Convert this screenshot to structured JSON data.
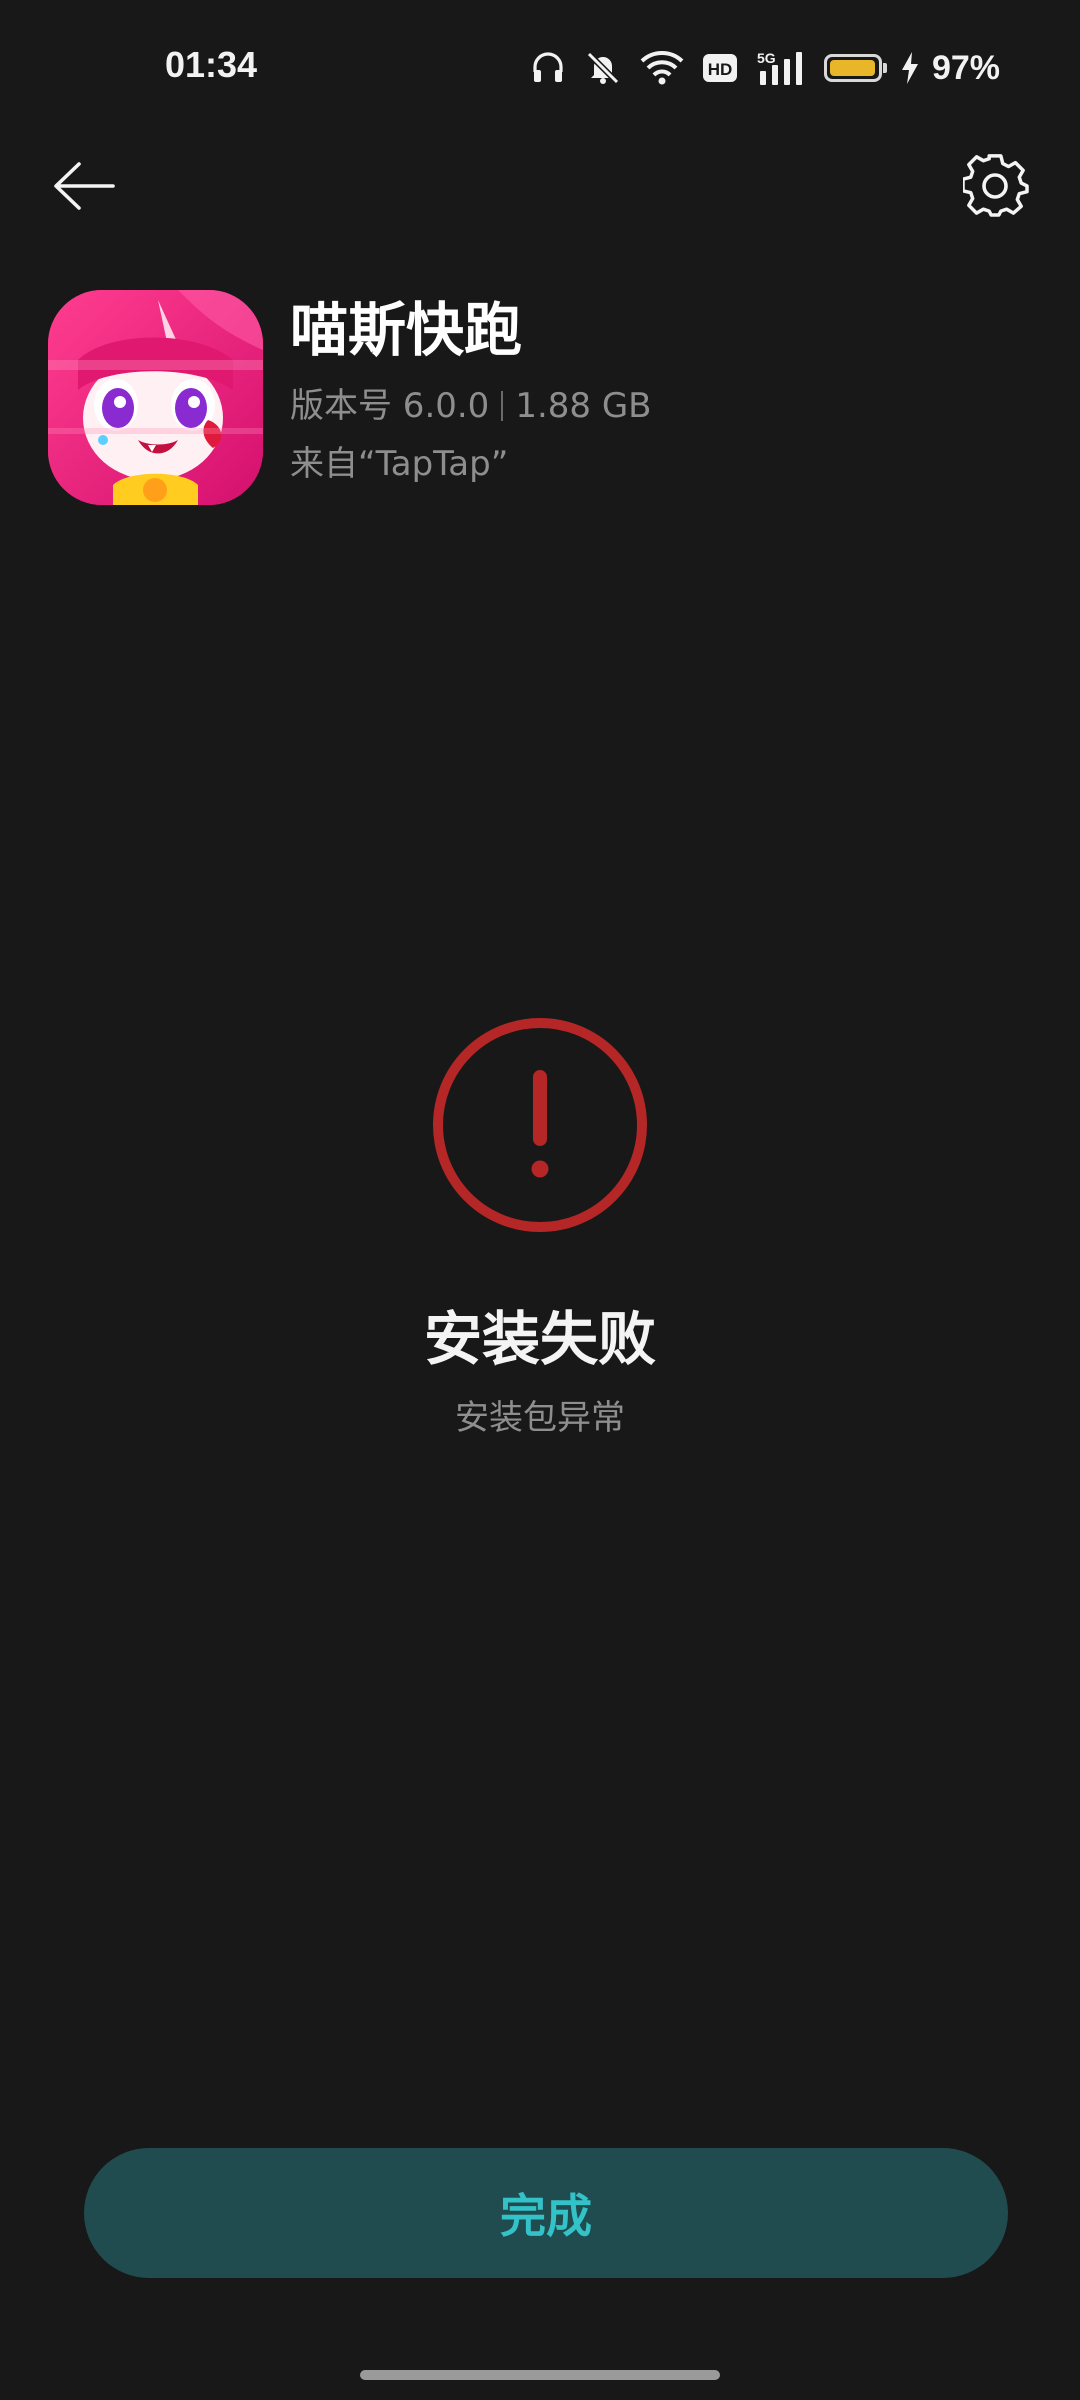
{
  "status_bar": {
    "time": "01:34",
    "battery_text": "97%",
    "network": "5G",
    "hd_label": "HD",
    "battery_level": 0.97,
    "battery_color": "#e8b628",
    "icons": [
      "headphones-icon",
      "mute-bell-icon",
      "wifi-icon",
      "hd-icon",
      "signal-5g-icon",
      "battery-icon",
      "charging-bolt-icon"
    ]
  },
  "topbar": {
    "back_icon": "back-arrow-icon",
    "settings_icon": "gear-icon"
  },
  "app": {
    "name": "喵斯快跑",
    "version": "版本号 6.0.0",
    "size": "1.88 GB",
    "source": "来自“TapTap”"
  },
  "result": {
    "icon": "error-exclamation-icon",
    "title": "安装失败",
    "subtitle": "安装包异常",
    "accent_color": "#b52626"
  },
  "actions": {
    "done_label": "完成",
    "done_bg": "#214c4f",
    "done_text_color": "#33c2c8"
  }
}
